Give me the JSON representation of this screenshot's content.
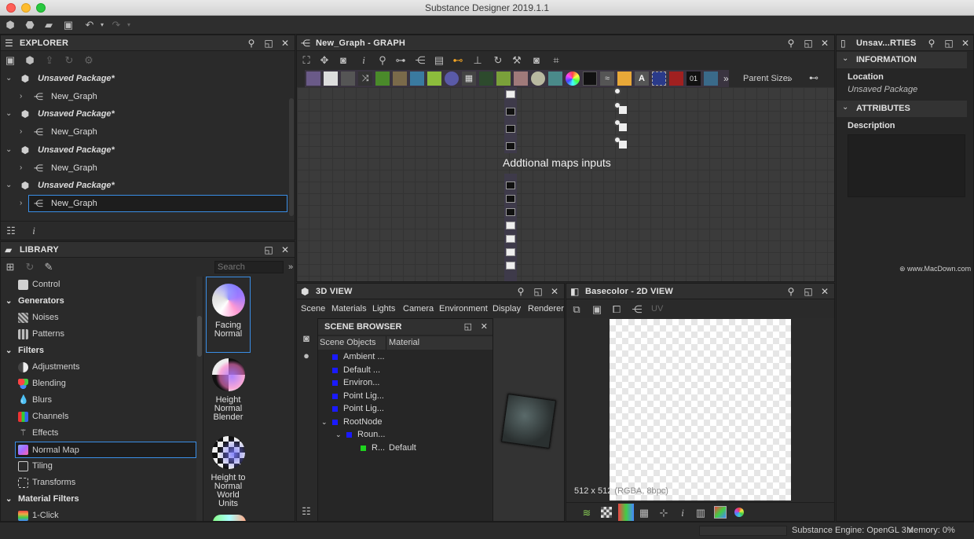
{
  "app": {
    "title": "Substance Designer 2019.1.1"
  },
  "explorer": {
    "title": "EXPLORER",
    "items": [
      {
        "package": "Unsaved Package*",
        "graph": "New_Graph"
      },
      {
        "package": "Unsaved Package*",
        "graph": "New_Graph"
      },
      {
        "package": "Unsaved Package*",
        "graph": "New_Graph"
      },
      {
        "package": "Unsaved Package*",
        "graph": "New_Graph"
      }
    ]
  },
  "library": {
    "title": "LIBRARY",
    "search_placeholder": "Search",
    "categories": [
      {
        "label": "Control",
        "type": "item",
        "icon": "control-icon"
      },
      {
        "label": "Generators",
        "type": "header"
      },
      {
        "label": "Noises",
        "type": "item",
        "icon": "noises-icon"
      },
      {
        "label": "Patterns",
        "type": "item",
        "icon": "patterns-icon"
      },
      {
        "label": "Filters",
        "type": "header"
      },
      {
        "label": "Adjustments",
        "type": "item",
        "icon": "adjustments-icon"
      },
      {
        "label": "Blending",
        "type": "item",
        "icon": "blending-icon"
      },
      {
        "label": "Blurs",
        "type": "item",
        "icon": "blurs-icon"
      },
      {
        "label": "Channels",
        "type": "item",
        "icon": "channels-icon"
      },
      {
        "label": "Effects",
        "type": "item",
        "icon": "effects-icon"
      },
      {
        "label": "Normal Map",
        "type": "item",
        "icon": "normal-map-icon",
        "selected": true
      },
      {
        "label": "Tiling",
        "type": "item",
        "icon": "tiling-icon"
      },
      {
        "label": "Transforms",
        "type": "item",
        "icon": "transforms-icon"
      },
      {
        "label": "Material Filters",
        "type": "header"
      },
      {
        "label": "1-Click",
        "type": "item",
        "icon": "one-click-icon"
      }
    ],
    "thumbnails": [
      {
        "label": "Facing Normal",
        "selected": true
      },
      {
        "label": "Height Normal Blender"
      },
      {
        "label": "Height to Normal World Units"
      }
    ]
  },
  "graph": {
    "title": "New_Graph - GRAPH",
    "parent_size_label": "Parent Size:",
    "comment": "Addtional maps inputs"
  },
  "properties": {
    "title": "Unsav...RTIES",
    "information_header": "INFORMATION",
    "location_label": "Location",
    "location_value": "Unsaved Package",
    "attributes_header": "ATTRIBUTES",
    "description_label": "Description",
    "watermark": "www.MacDown.com"
  },
  "view3d": {
    "title": "3D VIEW",
    "menu": [
      "Scene",
      "Materials",
      "Lights",
      "Camera",
      "Environment",
      "Display",
      "Renderer"
    ]
  },
  "scene_browser": {
    "title": "SCENE BROWSER",
    "columns": [
      "Scene Objects",
      "Material"
    ],
    "rows": [
      {
        "name": "Ambient ...",
        "material": "",
        "color": "#1a1aff"
      },
      {
        "name": "Default ...",
        "material": "",
        "color": "#1a1aff"
      },
      {
        "name": "Environ...",
        "material": "",
        "color": "#1a1aff"
      },
      {
        "name": "Point Lig...",
        "material": "",
        "color": "#1a1aff"
      },
      {
        "name": "Point Lig...",
        "material": "",
        "color": "#1a1aff"
      },
      {
        "name": "RootNode",
        "material": "",
        "color": "#1a1aff"
      },
      {
        "name": "Roun...",
        "material": "",
        "color": "#1a1aff"
      },
      {
        "name": "R...",
        "material": "Default",
        "color": "#1ed41e"
      }
    ]
  },
  "view2d": {
    "title": "Basecolor - 2D VIEW",
    "uv_label": "UV",
    "resolution": "512 x 512",
    "format": "(RGBA, 8bpc)"
  },
  "status": {
    "engine": "Substance Engine: OpenGL 3.x",
    "memory": "Memory: 0%"
  }
}
